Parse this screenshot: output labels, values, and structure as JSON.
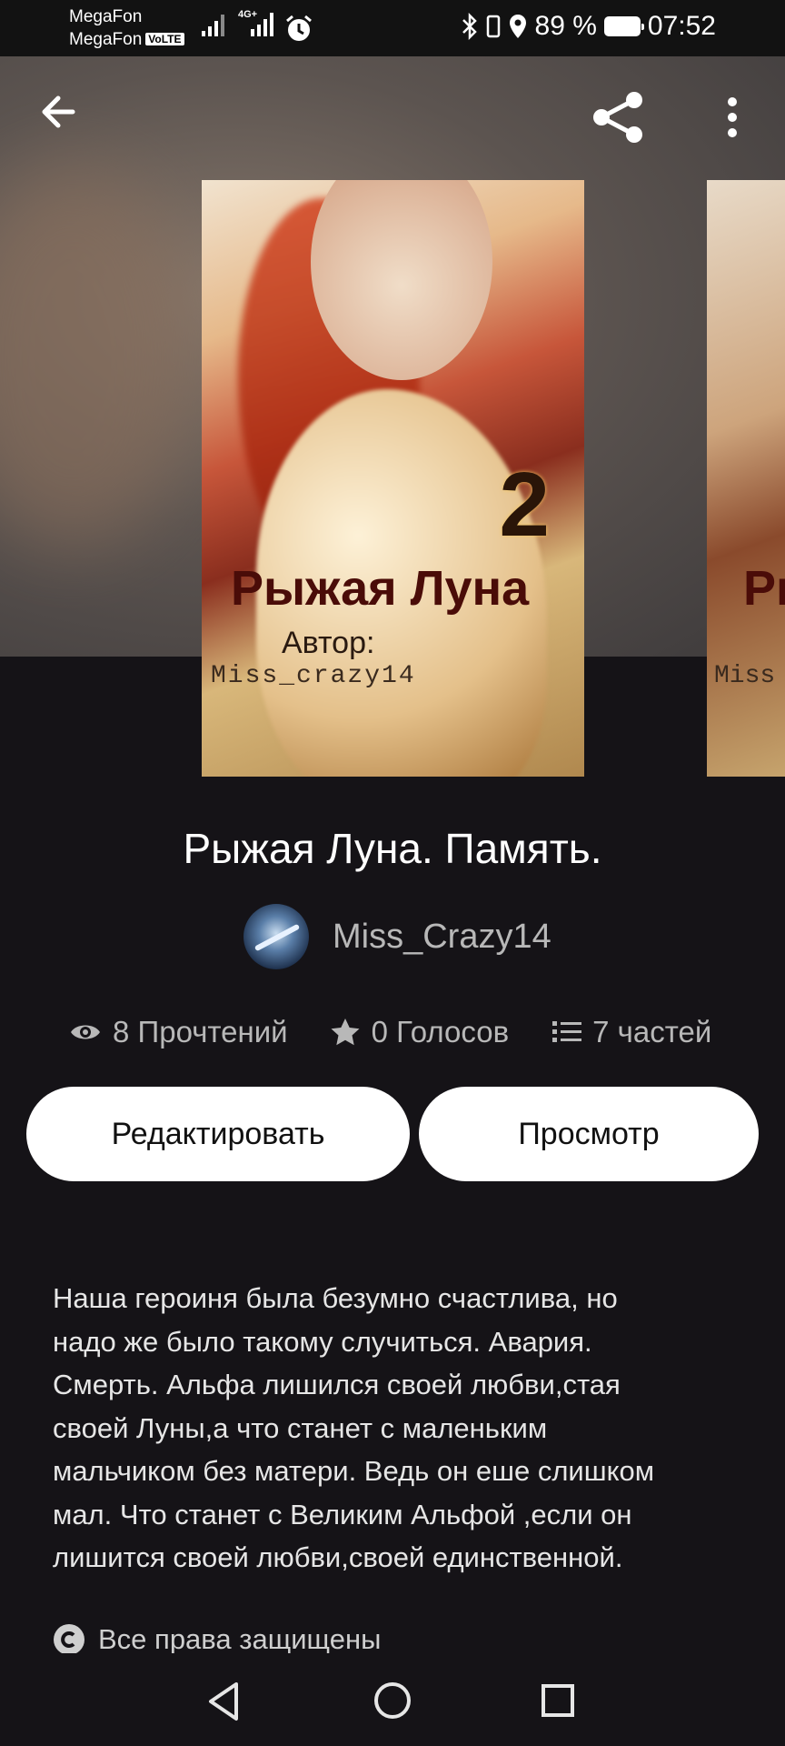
{
  "status_bar": {
    "carrier_1": "MegaFon",
    "carrier_2": "MegaFon",
    "volte": "VoLTE",
    "network": "4G+",
    "battery": "89 %",
    "time": "07:52"
  },
  "toolbar": {
    "back_icon": "arrow-left-icon",
    "share_icon": "share-icon",
    "menu_icon": "more-vertical-icon"
  },
  "cover": {
    "number": "2",
    "title": "Рыжая Луна",
    "author_label": "Автор:",
    "author_nick": "Miss_crazy14"
  },
  "cover_next": {
    "title_fragment": "Ры",
    "nick_fragment": "Miss"
  },
  "story": {
    "title": "Рыжая Луна. Память.",
    "author": "Miss_Crazy14"
  },
  "stats": {
    "reads": "8 Прочтений",
    "votes": "0 Голосов",
    "parts": "7 частей"
  },
  "buttons": {
    "edit": "Редактировать",
    "preview": "Просмотр"
  },
  "description": "Наша героиня была безумно счастлива, но\nнадо же было такому случиться. Авария.\nСмерть. Альфа лишился своей любви,стая\nсвоей Луны,а что станет с маленьким\nмальчиком без матери. Ведь он еше слишком\nмал. Что станет с Великим   Альфой ,если он\nлишится своей любви,своей единственной.",
  "copyright": "Все права защищены",
  "nav": {
    "back": "triangle-back-icon",
    "home": "circle-home-icon",
    "recents": "square-recents-icon"
  }
}
